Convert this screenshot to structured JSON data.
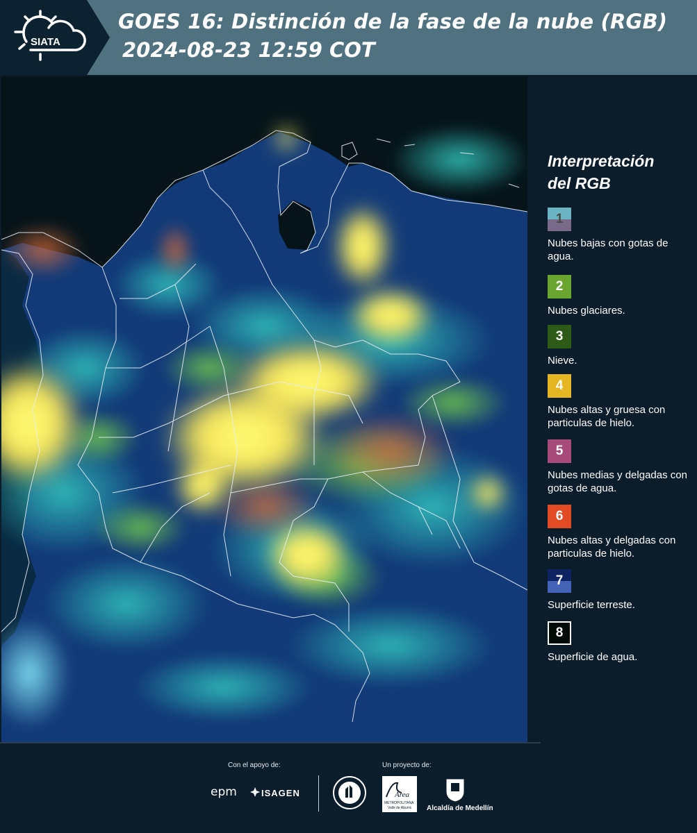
{
  "header": {
    "logo_text": "SIATA",
    "title_line1": "GOES 16: Distinción de la fase de la nube (RGB)",
    "title_line2": "2024-08-23 12:59 COT"
  },
  "legend": {
    "title_line1": "Interpretación",
    "title_line2": "del RGB",
    "items": [
      {
        "number": "1",
        "label": "Nubes bajas con gotas de agua.",
        "color_top": "#6ab4c4",
        "color_bottom": "#7a6a8a"
      },
      {
        "number": "2",
        "label": "Nubes glaciares.",
        "color_top": "#6aa52f",
        "color_bottom": "#6aa52f"
      },
      {
        "number": "3",
        "label": "Nieve.",
        "color_top": "#2e5a17",
        "color_bottom": "#2e5a17"
      },
      {
        "number": "4",
        "label": "Nubes altas y gruesa con particulas de hielo.",
        "color_top": "#e6b622",
        "color_bottom": "#e6b622"
      },
      {
        "number": "5",
        "label": "Nubes medias y delgadas con gotas de agua.",
        "color_top": "#a84a7a",
        "color_bottom": "#a84a7a"
      },
      {
        "number": "6",
        "label": "Nubes altas y delgadas con particulas de hielo.",
        "color_top": "#e24b24",
        "color_bottom": "#e24b24"
      },
      {
        "number": "7",
        "label": "Superficie terreste.",
        "color_top": "#0e2362",
        "color_bottom": "#4463b6"
      },
      {
        "number": "8",
        "label": "Superficie de agua.",
        "color_top": "#020c06",
        "color_bottom": "#020c06"
      }
    ]
  },
  "footer": {
    "support_label": "Con el apoyo de:",
    "project_label": "Un proyecto de:",
    "sponsor1": "epm",
    "sponsor2": "ISAGEN",
    "partner1": "Área",
    "partner1_sub1": "METROPOLITANA",
    "partner1_sub2": "Valle de Aburrá",
    "partner2": "Alcaldía de Medellín"
  }
}
